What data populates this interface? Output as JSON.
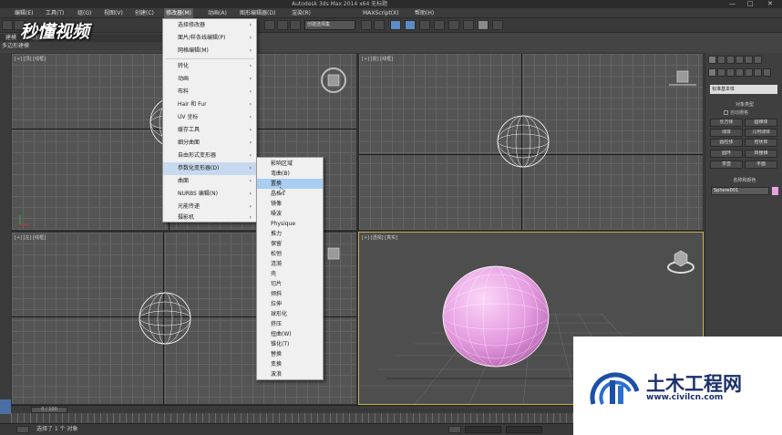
{
  "window": {
    "title": "Autodesk 3ds Max  2014 x64      无标题",
    "minimize": "—",
    "maximize": "□",
    "close": "✕"
  },
  "menubar": {
    "items": [
      "编辑(E)",
      "工具(T)",
      "组(G)",
      "视图(V)",
      "创建(C)",
      "修改器(M)",
      "动画(A)",
      "图形编辑器(D)",
      "渲染(R)",
      "MAXScript(X)",
      "帮助(H)"
    ]
  },
  "toolbar": {
    "selection_set": "创建选择集"
  },
  "ribbon": {
    "tabs": [
      "建模",
      "自由形式"
    ],
    "poly_label": "多边形建模"
  },
  "watermark": {
    "text": "秒懂视频"
  },
  "viewports": {
    "top": "[+] [顶] [线框]",
    "front": "[+] [前] [线框]",
    "left": "[+] [左] [线框]",
    "perspective": "[+] [透视] [真实]"
  },
  "modifier_menu": {
    "items": [
      {
        "label": "选择修改器",
        "arrow": "›"
      },
      {
        "label": "面片/样条线编辑(P)",
        "arrow": "›"
      },
      {
        "label": "网格编辑(M)",
        "arrow": "›"
      },
      {
        "label": "转化",
        "arrow": "›"
      },
      {
        "label": "动画",
        "arrow": "›"
      },
      {
        "label": "布料",
        "arrow": "›"
      },
      {
        "label": "Hair 和 Fur",
        "arrow": "›"
      },
      {
        "label": "UV 坐标",
        "arrow": "›"
      },
      {
        "label": "缓存工具",
        "arrow": "›"
      },
      {
        "label": "细分曲面",
        "arrow": "›"
      },
      {
        "label": "自由形式变形器",
        "arrow": "›"
      },
      {
        "label": "参数化变形器(D)",
        "arrow": "›"
      },
      {
        "label": "曲面",
        "arrow": "›"
      },
      {
        "label": "NURBS 编辑(N)",
        "arrow": "›"
      },
      {
        "label": "光能传递",
        "arrow": "›"
      },
      {
        "label": "摄影机",
        "arrow": "›"
      }
    ]
  },
  "param_submenu": {
    "items": [
      "影响区域",
      "弯曲(B)",
      "置换",
      "晶格",
      "镜像",
      "噪波",
      "Physique",
      "推力",
      "保留",
      "松弛",
      "涟漪",
      "壳",
      "切片",
      "倾斜",
      "拉伸",
      "球形化",
      "挤压",
      "扭曲(W)",
      "锥化(T)",
      "替换",
      "变换",
      "波浪"
    ]
  },
  "command_panel": {
    "category": "标准基本体",
    "section_object_type": "对象类型",
    "autogrid": "自动栅格",
    "buttons": [
      "长方体",
      "圆锥体",
      "球体",
      "几何球体",
      "圆柱体",
      "管状体",
      "圆环",
      "四棱锥",
      "茶壶",
      "平面"
    ],
    "section_name_color": "名称和颜色",
    "object_name": "Sphere001",
    "object_color": "#e8a2e3"
  },
  "timeline": {
    "frame": "0 / 100"
  },
  "statusbar": {
    "message": "选择了 1 个 对象"
  },
  "site_logo": {
    "name": "土木工程网",
    "url": "www.civilcn.com"
  }
}
